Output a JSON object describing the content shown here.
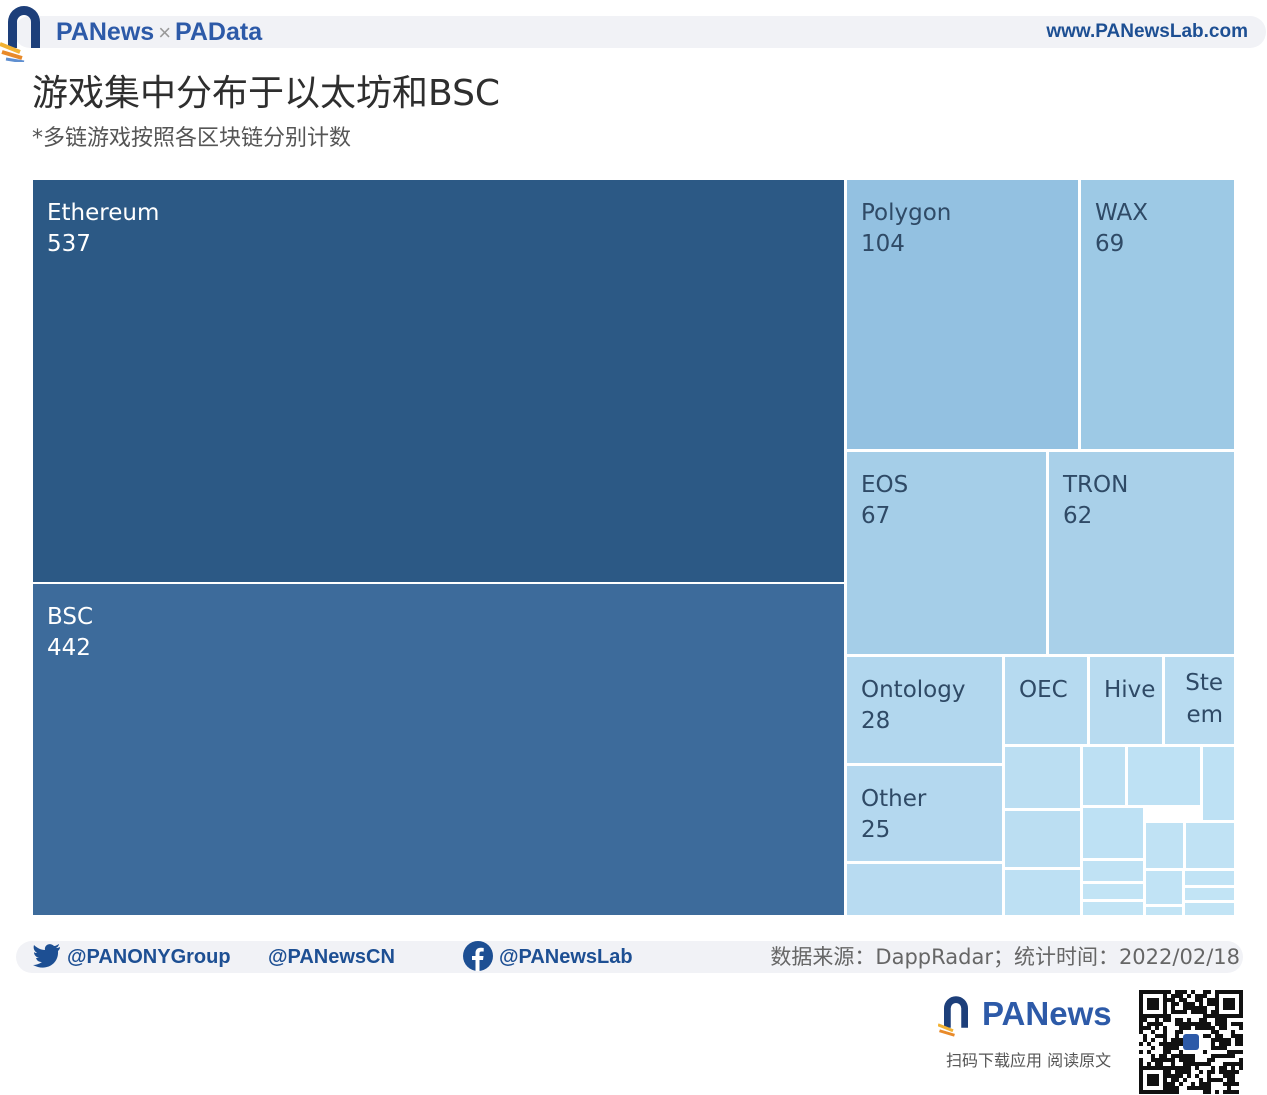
{
  "header": {
    "brand_main": "PANews",
    "brand_sep": "×",
    "brand_second": "PAData",
    "site_url": "www.PANewsLab.com"
  },
  "title": "游戏集中分布于以太坊和BSC",
  "subtitle": "*多链游戏按照各区块链分别计数",
  "chart_data": {
    "type": "treemap",
    "title": "游戏集中分布于以太坊和BSC",
    "subtitle": "*多链游戏按照各区块链分别计数",
    "items": [
      {
        "name": "Ethereum",
        "value": 537,
        "label": "537",
        "color": "#2c5985"
      },
      {
        "name": "BSC",
        "value": 442,
        "label": "442",
        "color": "#3d6b9b"
      },
      {
        "name": "Polygon",
        "value": 104,
        "label": "104",
        "color": "#93c1e1"
      },
      {
        "name": "WAX",
        "value": 69,
        "label": "69",
        "color": "#9dc9e5"
      },
      {
        "name": "EOS",
        "value": 67,
        "label": "67",
        "color": "#a5cee8"
      },
      {
        "name": "TRON",
        "value": 62,
        "label": "62",
        "color": "#a9d0e9"
      },
      {
        "name": "Ontology",
        "value": 28,
        "label": "28",
        "color": "#b2d7ee"
      },
      {
        "name": "Other",
        "value": 25,
        "label": "25",
        "color": "#b4d8ef"
      },
      {
        "name": "OEC",
        "value": 14,
        "label": "",
        "color": "#b6daf0"
      },
      {
        "name": "Hive",
        "value": 12,
        "label": "",
        "color": "#b8dbf0"
      },
      {
        "name": "Ste\nem",
        "value": 10,
        "label": "",
        "color": "#b9dcf1"
      },
      {
        "name": "",
        "value": 12,
        "label": "",
        "color": "#b8dbf1"
      },
      {
        "name": "",
        "value": 8,
        "label": "",
        "color": "#bbdef2"
      },
      {
        "name": "",
        "value": 8,
        "label": "",
        "color": "#bbdef2"
      },
      {
        "name": "",
        "value": 6,
        "label": "",
        "color": "#bde0f3"
      },
      {
        "name": "",
        "value": 5,
        "label": "",
        "color": "#bde0f3"
      },
      {
        "name": "",
        "value": 5,
        "label": "",
        "color": "#bee1f4"
      },
      {
        "name": "",
        "value": 4,
        "label": "",
        "color": "#bee1f4"
      },
      {
        "name": "",
        "value": 4,
        "label": "",
        "color": "#bee1f4"
      },
      {
        "name": "",
        "value": 3,
        "label": "",
        "color": "#c0e2f4"
      },
      {
        "name": "",
        "value": 3,
        "label": "",
        "color": "#c0e2f4"
      },
      {
        "name": "",
        "value": 2,
        "label": "",
        "color": "#c0e2f4"
      },
      {
        "name": "",
        "value": 2,
        "label": "",
        "color": "#c1e3f5"
      },
      {
        "name": "",
        "value": 2,
        "label": "",
        "color": "#c1e3f5"
      },
      {
        "name": "",
        "value": 1,
        "label": "",
        "color": "#c2e4f5"
      },
      {
        "name": "",
        "value": 1,
        "label": "",
        "color": "#c2e4f5"
      },
      {
        "name": "",
        "value": 1,
        "label": "",
        "color": "#c2e4f5"
      },
      {
        "name": "",
        "value": 1,
        "label": "",
        "color": "#c2e4f5"
      },
      {
        "name": "",
        "value": 1,
        "label": "",
        "color": "#c2e4f5"
      }
    ]
  },
  "footer": {
    "twitter": "@PANONYGroup",
    "weibo": "@PANewsCN",
    "facebook": "@PANewsLab",
    "source": "数据来源：DappRadar；统计时间：2022/02/18",
    "brand": "PANews",
    "tagline": "扫码下载应用  阅读原文"
  }
}
